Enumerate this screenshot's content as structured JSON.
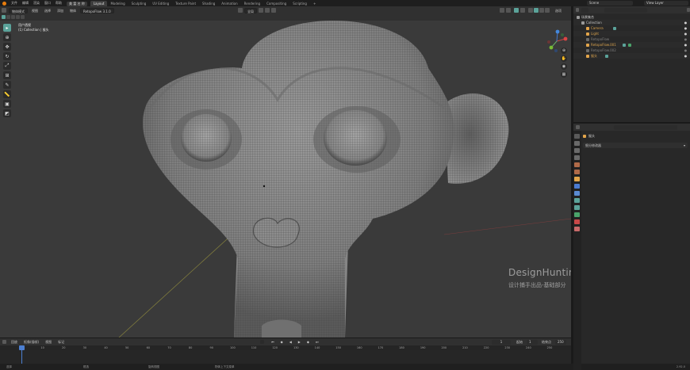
{
  "menu": {
    "items": [
      "文件",
      "编辑",
      "渲染",
      "窗口",
      "帮助"
    ],
    "workspace_btn": "美 富 名 称"
  },
  "workspaces": [
    "Layout",
    "Modeling",
    "Sculpting",
    "UV Editing",
    "Texture Paint",
    "Shading",
    "Animation",
    "Rendering",
    "Compositing",
    "Scripting"
  ],
  "top_right": {
    "scene_label": "Scene",
    "view_layer_label": "View Layer"
  },
  "viewport_header": {
    "mode_dropdown": "物体模式",
    "menu_items": [
      "视图",
      "选择",
      "添加",
      "物体"
    ],
    "addon_dropdown": "RetopoFlow 3.1.0",
    "transform_orient": "全局",
    "options_label": "选项"
  },
  "viewport": {
    "view_name": "用户透视",
    "collection_info": "(1) Collection | 猴头"
  },
  "watermark": {
    "title": "DesignHunting",
    "subtitle": "设计捕手出品-基础部分"
  },
  "timeline": {
    "header_items": [
      "回放",
      "抠像(插帧)",
      "视图",
      "标记"
    ],
    "current_frame": "1",
    "start_label": "起始",
    "start_value": "1",
    "end_label": "结束点",
    "end_value": "250",
    "ticks": [
      "0",
      "10",
      "20",
      "30",
      "40",
      "50",
      "60",
      "70",
      "80",
      "90",
      "100",
      "110",
      "120",
      "130",
      "140",
      "150",
      "160",
      "170",
      "180",
      "190",
      "200",
      "210",
      "220",
      "230",
      "240",
      "250"
    ]
  },
  "statusbar": {
    "left_items": [
      "选择",
      "框选",
      "旋转视图",
      "物体上下文菜单"
    ],
    "version": "2.92.0"
  },
  "outliner": {
    "rows": [
      {
        "label": "场景集合",
        "indent": 0,
        "color": "#c8c8c8"
      },
      {
        "label": "Collection",
        "indent": 1,
        "color": "#c8c8c8"
      },
      {
        "label": "Camera",
        "indent": 2,
        "color": "#e3a54a"
      },
      {
        "label": "Light",
        "indent": 2,
        "color": "#e3a54a"
      },
      {
        "label": "RetopoFlow",
        "indent": 2,
        "color": "#7f7f7f"
      },
      {
        "label": "RetopoFlow.001",
        "indent": 2,
        "color": "#e3a54a"
      },
      {
        "label": "RetopoFlow.002",
        "indent": 2,
        "color": "#7f7f7f"
      },
      {
        "label": "猴头",
        "indent": 2,
        "color": "#e3a54a"
      }
    ]
  },
  "properties": {
    "object_name": "猴头",
    "subsection": "细分修改器"
  },
  "colors": {
    "accent": "#5ba39a",
    "object_orange": "#e3a54a",
    "header_bg": "#303030",
    "viewport_bg": "#3a3a3a",
    "playhead_blue": "#4c7fd1"
  }
}
